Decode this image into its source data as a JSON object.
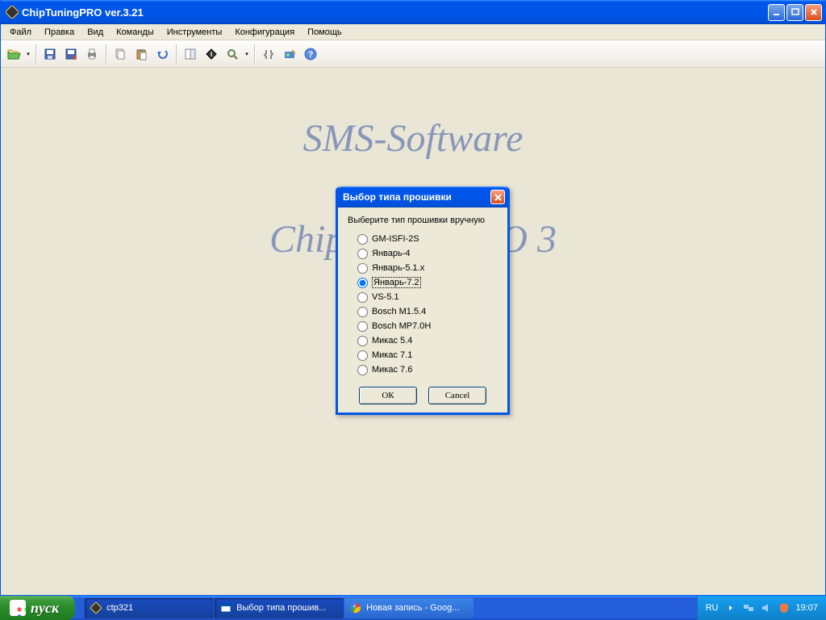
{
  "window": {
    "title": "ChipTuningPRO ver.3.21"
  },
  "menu": {
    "items": [
      "Файл",
      "Правка",
      "Вид",
      "Команды",
      "Инструменты",
      "Конфигурация",
      "Помощь"
    ]
  },
  "watermark": {
    "line1": "SMS-Software",
    "line2": "ChipTuningPRO 3"
  },
  "dialog": {
    "title": "Выбор типа прошивки",
    "prompt": "Выберите тип прошивки вручную",
    "options": [
      "GM-ISFI-2S",
      "Январь-4",
      "Январь-5.1.x",
      "Январь-7.2",
      "VS-5.1",
      "Bosch M1.5.4",
      "Bosch MP7.0H",
      "Микас 5.4",
      "Микас 7.1",
      "Микас 7.6"
    ],
    "selected_index": 3,
    "ok": "ОК",
    "cancel": "Cancel"
  },
  "taskbar": {
    "start": "пуск",
    "items": [
      {
        "label": "ctp321",
        "active": true
      },
      {
        "label": "Выбор типа прошив...",
        "active": true
      },
      {
        "label": "Новая запись - Goog...",
        "active": false
      }
    ],
    "lang": "RU",
    "clock": "19:07"
  }
}
